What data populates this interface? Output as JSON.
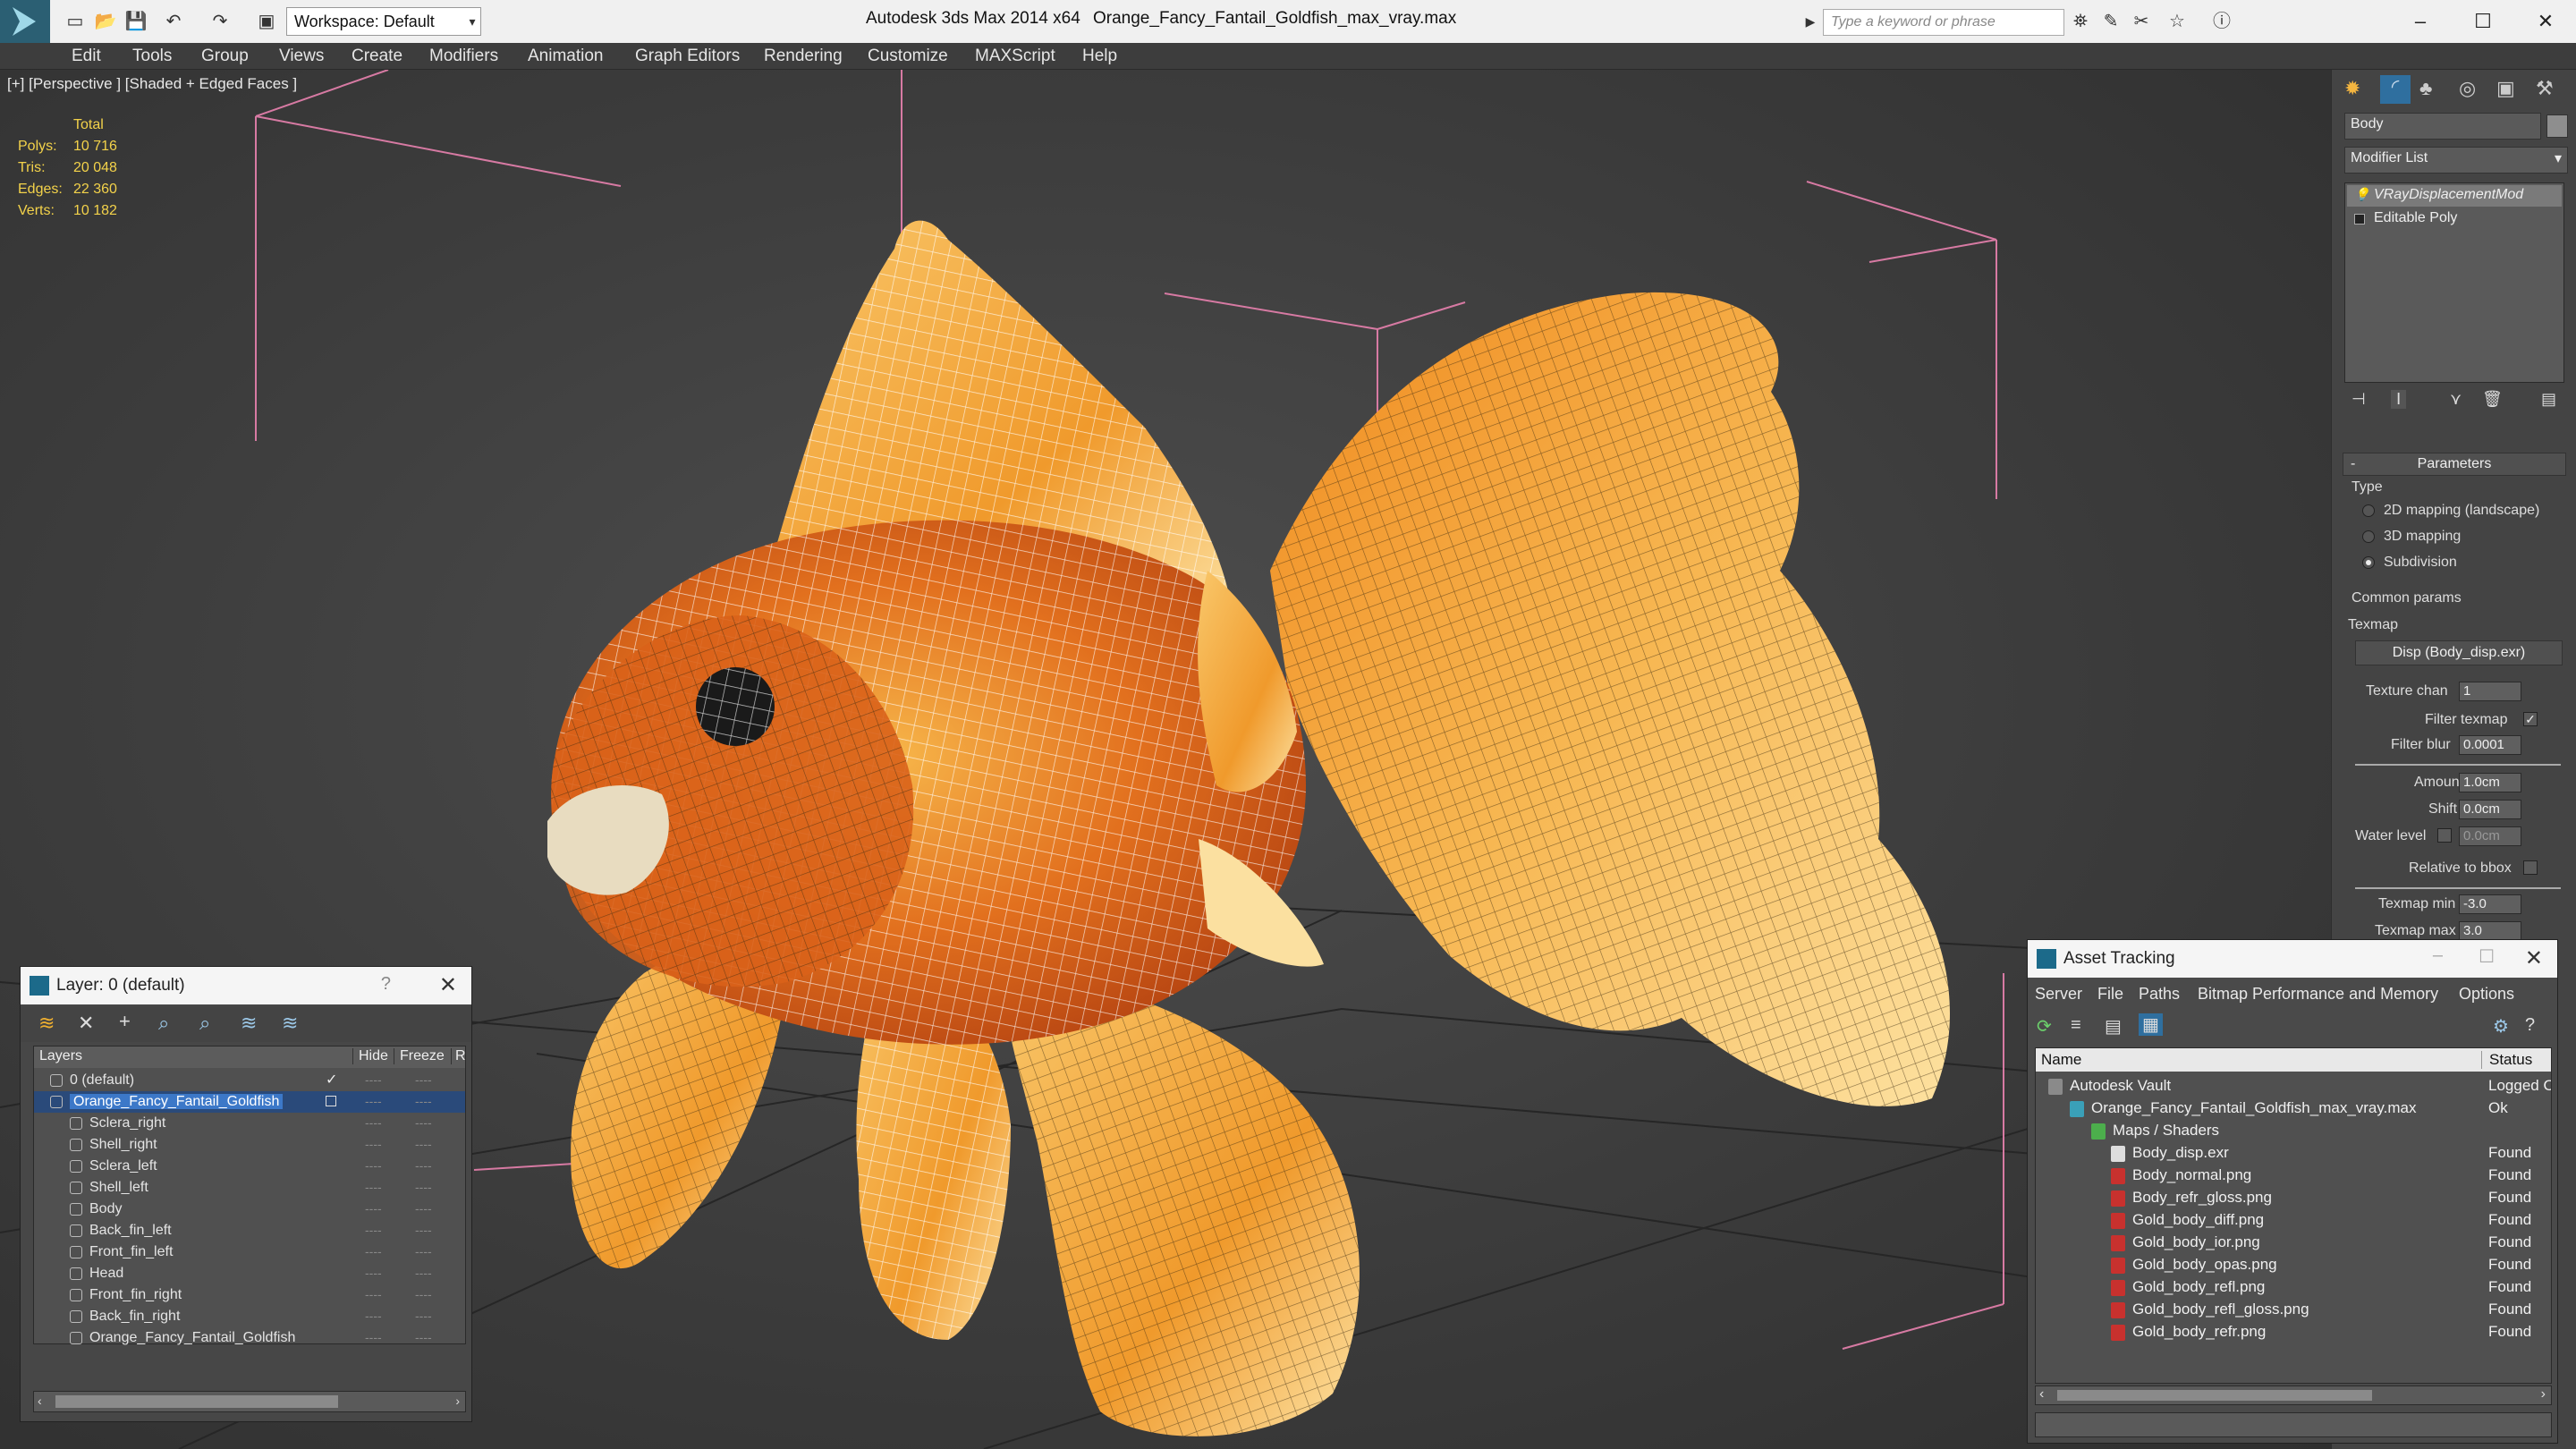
{
  "app": {
    "title": "Autodesk 3ds Max 2014 x64",
    "filename": "Orange_Fancy_Fantail_Goldfish_max_vray.max",
    "workspace": "Workspace: Default",
    "search_placeholder": "Type a keyword or phrase"
  },
  "menu": [
    "Edit",
    "Tools",
    "Group",
    "Views",
    "Create",
    "Modifiers",
    "Animation",
    "Graph Editors",
    "Rendering",
    "Customize",
    "MAXScript",
    "Help"
  ],
  "viewport": {
    "label": "[+] [Perspective ] [Shaded + Edged Faces ]",
    "stats": {
      "header": "Total",
      "rows": [
        {
          "label": "Polys:",
          "value": "10 716"
        },
        {
          "label": "Tris:",
          "value": "20 048"
        },
        {
          "label": "Edges:",
          "value": "22 360"
        },
        {
          "label": "Verts:",
          "value": "10 182"
        }
      ]
    }
  },
  "command_panel": {
    "object_name": "Body",
    "modifier_list": "Modifier List",
    "stack": [
      "VRayDisplacementMod",
      "Editable Poly"
    ],
    "parameters": {
      "rollout": "Parameters",
      "type_label": "Type",
      "types": [
        "2D mapping (landscape)",
        "3D mapping",
        "Subdivision"
      ],
      "selected_type": "Subdivision",
      "common_label": "Common params",
      "texmap_label": "Texmap",
      "texmap_button": "Disp (Body_disp.exr)",
      "texture_chan_label": "Texture chan",
      "texture_chan": "1",
      "filter_texmap_label": "Filter texmap",
      "filter_blur_label": "Filter blur",
      "filter_blur": "0.0001",
      "amount_label": "Amount",
      "amount": "1.0cm",
      "shift_label": "Shift",
      "shift": "0.0cm",
      "water_level_label": "Water level",
      "water_level": "0.0cm",
      "relative_bbox_label": "Relative to bbox",
      "texmap_min_label": "Texmap min",
      "texmap_min": "-3.0",
      "texmap_max_label": "Texmap max",
      "texmap_max": "3.0"
    }
  },
  "layer_window": {
    "title": "Layer: 0 (default)",
    "help": "?",
    "columns": [
      "Layers",
      "Hide",
      "Freeze",
      "R"
    ],
    "layers": [
      {
        "name": "0 (default)",
        "level": 0
      },
      {
        "name": "Orange_Fancy_Fantail_Goldfish",
        "level": 0,
        "selected": true
      },
      {
        "name": "Sclera_right",
        "level": 1
      },
      {
        "name": "Shell_right",
        "level": 1
      },
      {
        "name": "Sclera_left",
        "level": 1
      },
      {
        "name": "Shell_left",
        "level": 1
      },
      {
        "name": "Body",
        "level": 1
      },
      {
        "name": "Back_fin_left",
        "level": 1
      },
      {
        "name": "Front_fin_left",
        "level": 1
      },
      {
        "name": "Head",
        "level": 1
      },
      {
        "name": "Front_fin_right",
        "level": 1
      },
      {
        "name": "Back_fin_right",
        "level": 1
      },
      {
        "name": "Orange_Fancy_Fantail_Goldfish",
        "level": 1
      }
    ],
    "dash": "----"
  },
  "asset_window": {
    "title": "Asset Tracking",
    "menu": [
      "Server",
      "File",
      "Paths",
      "Bitmap Performance and Memory",
      "Options"
    ],
    "columns": [
      "Name",
      "Status"
    ],
    "rows": [
      {
        "name": "Autodesk Vault",
        "status": "Logged O",
        "level": 0,
        "kind": "vault"
      },
      {
        "name": "Orange_Fancy_Fantail_Goldfish_max_vray.max",
        "status": "Ok",
        "level": 1,
        "kind": "max"
      },
      {
        "name": "Maps / Shaders",
        "status": "",
        "level": 2,
        "kind": "folder"
      },
      {
        "name": "Body_disp.exr",
        "status": "Found",
        "level": 3,
        "kind": "exr"
      },
      {
        "name": "Body_normal.png",
        "status": "Found",
        "level": 3,
        "kind": "png"
      },
      {
        "name": "Body_refr_gloss.png",
        "status": "Found",
        "level": 3,
        "kind": "png"
      },
      {
        "name": "Gold_body_diff.png",
        "status": "Found",
        "level": 3,
        "kind": "png"
      },
      {
        "name": "Gold_body_ior.png",
        "status": "Found",
        "level": 3,
        "kind": "png"
      },
      {
        "name": "Gold_body_opas.png",
        "status": "Found",
        "level": 3,
        "kind": "png"
      },
      {
        "name": "Gold_body_refl.png",
        "status": "Found",
        "level": 3,
        "kind": "png"
      },
      {
        "name": "Gold_body_refl_gloss.png",
        "status": "Found",
        "level": 3,
        "kind": "png"
      },
      {
        "name": "Gold_body_refr.png",
        "status": "Found",
        "level": 3,
        "kind": "png"
      }
    ]
  }
}
